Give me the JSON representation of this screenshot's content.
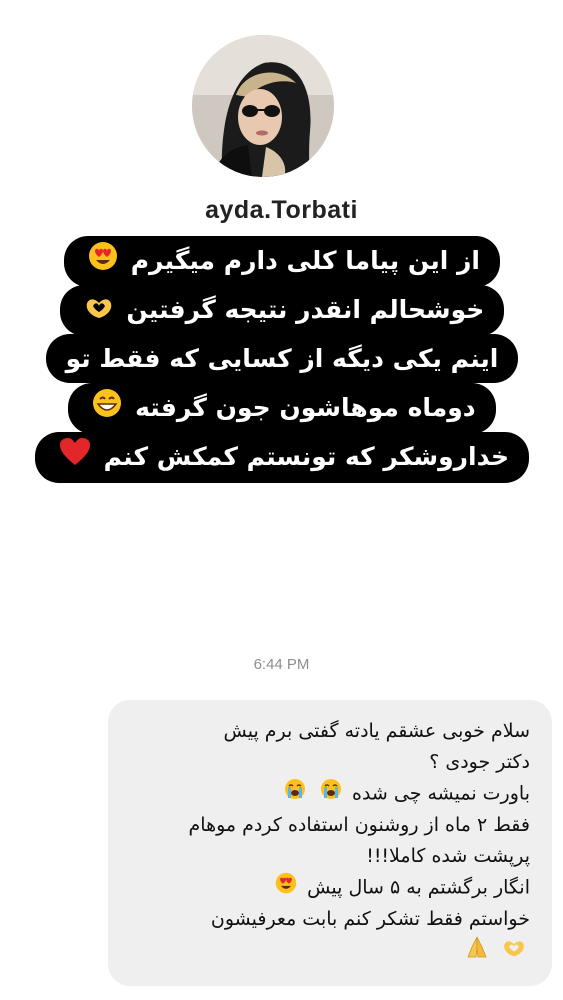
{
  "profile": {
    "username": "ayda.Torbati",
    "avatar": "profile-photo-woman-sunglasses-headscarf"
  },
  "caption": {
    "lines": [
      "از این پیاما کلی دارم میگیرم",
      "خوشحالم انقدر نتیجه گرفتین",
      "اینم یکی دیگه از کسایی که فقط تو",
      "دوماه موهاشون جون گرفته",
      "خداروشکر که تونستم کمکش کنم"
    ],
    "icons": [
      "heart-eyes-emoji",
      "heart-hands-emoji",
      "grinning-emoji",
      "red-heart-emoji"
    ]
  },
  "timestamp": "6:44 PM",
  "message": {
    "lines": [
      "سلام خوبی عشقم یادته گفتی برم پیش",
      "دکتر جودی ؟",
      "باورت نمیشه چی شده",
      "فقط ۲ ماه از روشنون استفاده کردم موهام",
      "پرپشت شده کاملا!!!",
      "انگار برگشتم به ۵ سال پیش",
      "خواستم فقط تشکر کنم بابت معرفیشون"
    ],
    "icons": [
      "crying-emoji",
      "heart-eyes-emoji",
      "heart-hands-emoji",
      "folded-hands-emoji"
    ]
  },
  "colors": {
    "caption_bg": "#000000",
    "caption_text": "#ffffff",
    "bubble_bg": "#efefef",
    "timestamp": "#8e8e8e"
  }
}
